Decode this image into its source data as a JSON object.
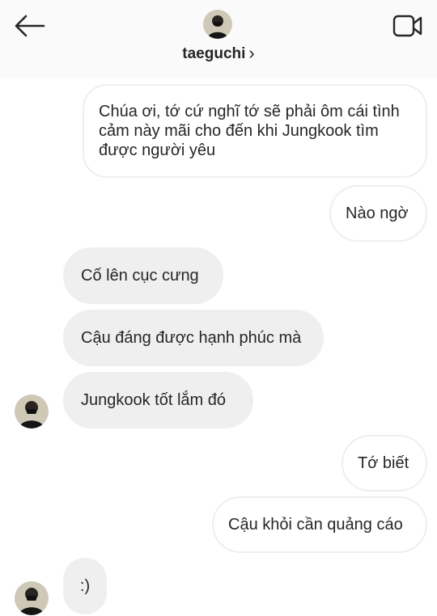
{
  "header": {
    "username": "taeguchi",
    "chevron": "›",
    "back_icon": "arrow-left-icon",
    "call_icon": "video-camera-icon"
  },
  "colors": {
    "header_bg": "#fafafa",
    "received_bubble": "#efefef",
    "sent_border": "#efefef",
    "text": "#262626"
  },
  "messages": [
    {
      "from": "me",
      "text": "Chúa ơi, tớ cứ nghĩ tớ sẽ phải ôm cái tình cảm này mãi cho đến khi Jungkook tìm được người yêu"
    },
    {
      "from": "me",
      "text": "Nào ngờ"
    },
    {
      "from": "them",
      "text": "Cố lên cục cưng"
    },
    {
      "from": "them",
      "text": "Cậu đáng được hạnh phúc mà"
    },
    {
      "from": "them",
      "text": "Jungkook tốt lắm đó"
    },
    {
      "from": "me",
      "text": "Tớ biết"
    },
    {
      "from": "me",
      "text": "Cậu khỏi cần quảng cáo"
    },
    {
      "from": "them",
      "text": ":)"
    }
  ]
}
